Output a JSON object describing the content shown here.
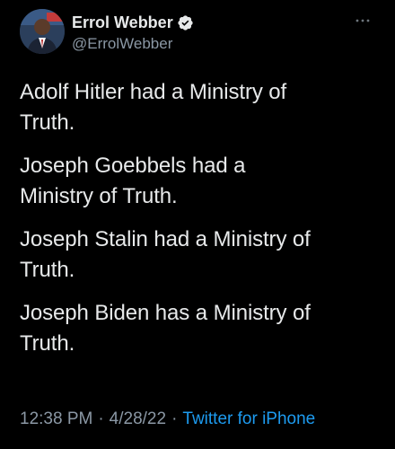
{
  "author": {
    "display_name": "Errol Webber",
    "handle": "@ErrolWebber",
    "verified": true,
    "avatar_icon": "profile-photo"
  },
  "menu_icon": "more-options-icon",
  "tweet": {
    "paragraphs": [
      "Adolf Hitler had a Ministry of\nTruth.",
      "Joseph Goebbels had a\nMinistry of Truth.",
      "Joseph Stalin had a Ministry of\nTruth.",
      "Joseph Biden has a Ministry of\nTruth."
    ]
  },
  "meta": {
    "time": "12:38 PM",
    "separator": "·",
    "date": "4/28/22",
    "source": "Twitter for iPhone"
  },
  "colors": {
    "background": "#000000",
    "text": "#e7e9ea",
    "secondary": "#8b98a5",
    "link": "#1d9bf0"
  }
}
